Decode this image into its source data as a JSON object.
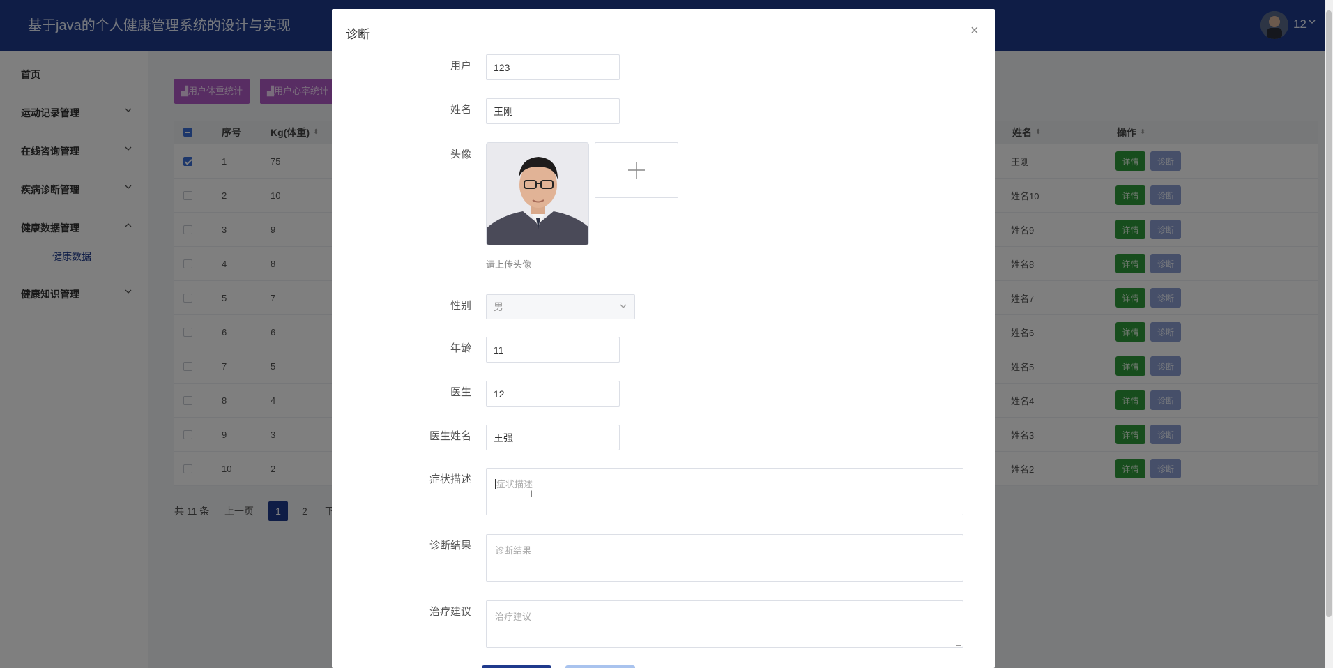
{
  "header": {
    "title": "基于java的个人健康管理系统的设计与实现",
    "user": "12"
  },
  "sidebar": {
    "items": [
      {
        "label": "首页"
      },
      {
        "label": "运动记录管理"
      },
      {
        "label": "在线咨询管理"
      },
      {
        "label": "疾病诊断管理"
      },
      {
        "label": "健康数据管理"
      },
      {
        "label": "健康知识管理"
      }
    ],
    "sub_item": "健康数据"
  },
  "toolbar": {
    "weight_stat": "用户体重统计",
    "heart_stat": "用户心率统计"
  },
  "table": {
    "headers": {
      "index": "序号",
      "weight": "Kg(体重)",
      "name": "姓名",
      "ops": "操作"
    },
    "detail_label": "详情",
    "diagnose_label": "诊断",
    "rows": [
      {
        "index": "1",
        "weight": "75",
        "name": "王刚"
      },
      {
        "index": "2",
        "weight": "10",
        "name": "姓名10"
      },
      {
        "index": "3",
        "weight": "9",
        "name": "姓名9"
      },
      {
        "index": "4",
        "weight": "8",
        "name": "姓名8"
      },
      {
        "index": "5",
        "weight": "7",
        "name": "姓名7"
      },
      {
        "index": "6",
        "weight": "6",
        "name": "姓名6"
      },
      {
        "index": "7",
        "weight": "5",
        "name": "姓名5"
      },
      {
        "index": "8",
        "weight": "4",
        "name": "姓名4"
      },
      {
        "index": "9",
        "weight": "3",
        "name": "姓名3"
      },
      {
        "index": "10",
        "weight": "2",
        "name": "姓名2"
      }
    ]
  },
  "pagination": {
    "total": "共 11 条",
    "prev": "上一页",
    "current": "1",
    "page2": "2",
    "next": "下"
  },
  "modal": {
    "title": "诊断",
    "close": "×",
    "labels": {
      "user": "用户",
      "name": "姓名",
      "avatar": "头像",
      "gender": "性别",
      "age": "年龄",
      "doctor": "医生",
      "doctor_name": "医生姓名",
      "symptom": "症状描述",
      "result": "诊断结果",
      "advice": "治疗建议"
    },
    "values": {
      "user": "123",
      "name": "王刚",
      "gender": "男",
      "age": "11",
      "doctor": "12",
      "doctor_name": "王强"
    },
    "avatar_hint": "请上传头像",
    "placeholders": {
      "symptom": "症状描述",
      "result": "诊断结果",
      "advice": "治疗建议"
    }
  }
}
